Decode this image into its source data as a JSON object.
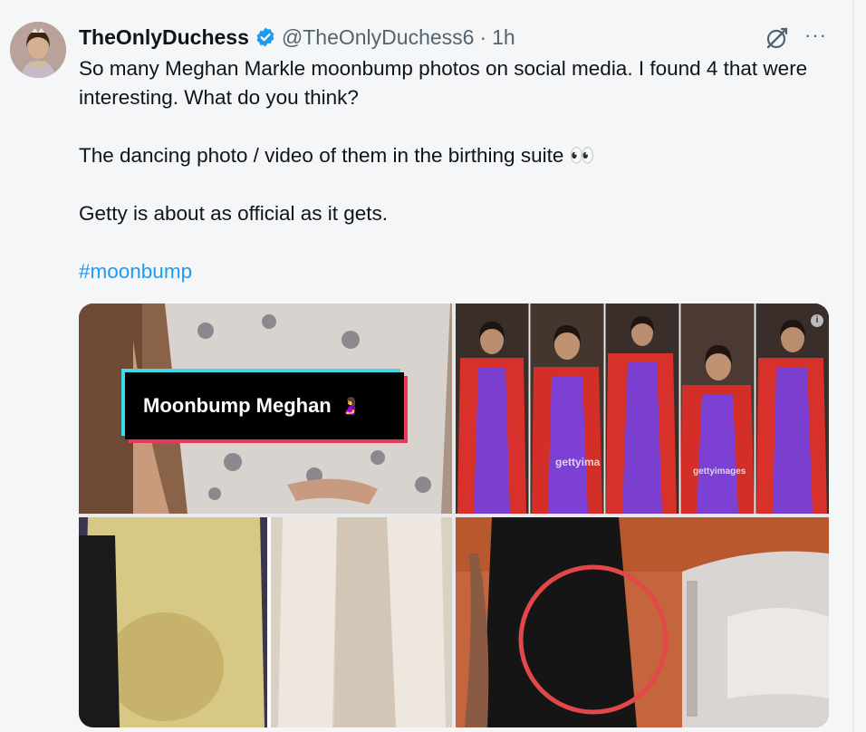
{
  "tweet": {
    "display_name": "TheOnlyDuchess",
    "handle": "@TheOnlyDuchess6",
    "separator": "·",
    "time": "1h",
    "more_label": "···",
    "paragraphs": [
      "So many Meghan Markle moonbump photos on social media. I found 4 that were interesting. What do you think?",
      "The dancing photo / video of them in the birthing suite 👀",
      "Getty is about as official as it gets."
    ],
    "hashtag": "#moonbump"
  },
  "media": {
    "badge_text": "Moonbump Meghan",
    "badge_emoji": "🤰",
    "watermark_getty": "gettyima",
    "watermark_getty2": "gettyimages",
    "info_glyph": "i"
  },
  "colors": {
    "link": "#1d9bf0",
    "verified": "#1d9bf0",
    "secondary_text": "#536471"
  },
  "icons": [
    "verified-badge-icon",
    "grok-icon",
    "more-icon",
    "info-icon"
  ]
}
